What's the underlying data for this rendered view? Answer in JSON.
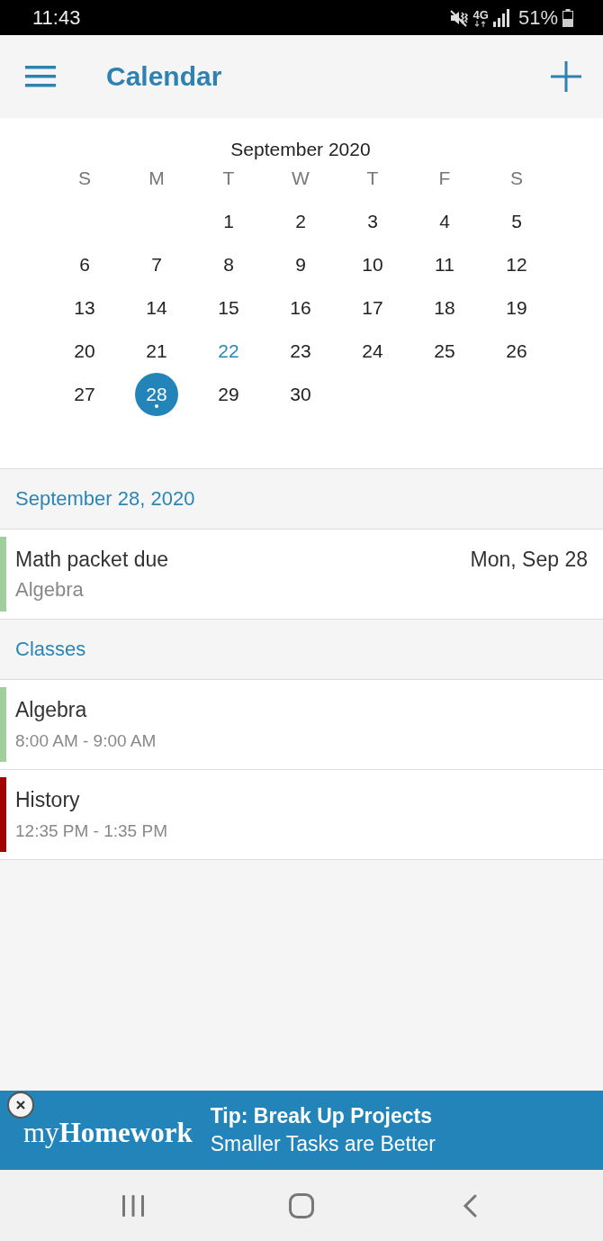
{
  "status_bar": {
    "time": "11:43",
    "network": "4G",
    "battery": "51%"
  },
  "app_bar": {
    "title": "Calendar"
  },
  "calendar": {
    "month": "September 2020",
    "weekdays": [
      "S",
      "M",
      "T",
      "W",
      "T",
      "F",
      "S"
    ],
    "weeks": [
      [
        {
          "day": "1",
          "selected": false,
          "today": false,
          "event": false
        },
        {
          "day": "2",
          "selected": false,
          "today": false,
          "event": false
        },
        {
          "day": "3",
          "selected": false,
          "today": false,
          "event": false
        },
        {
          "day": "4",
          "selected": false,
          "today": false,
          "event": false
        },
        {
          "day": "5",
          "selected": false,
          "today": false,
          "event": false
        }
      ],
      [
        {
          "day": "6",
          "selected": false,
          "today": false,
          "event": false
        },
        {
          "day": "7",
          "selected": false,
          "today": false,
          "event": false
        },
        {
          "day": "8",
          "selected": false,
          "today": false,
          "event": false
        },
        {
          "day": "9",
          "selected": false,
          "today": false,
          "event": false
        },
        {
          "day": "10",
          "selected": false,
          "today": false,
          "event": false
        },
        {
          "day": "11",
          "selected": false,
          "today": false,
          "event": false
        },
        {
          "day": "12",
          "selected": false,
          "today": false,
          "event": false
        }
      ],
      [
        {
          "day": "13",
          "selected": false,
          "today": false,
          "event": false
        },
        {
          "day": "14",
          "selected": false,
          "today": false,
          "event": false
        },
        {
          "day": "15",
          "selected": false,
          "today": false,
          "event": false
        },
        {
          "day": "16",
          "selected": false,
          "today": false,
          "event": false
        },
        {
          "day": "17",
          "selected": false,
          "today": false,
          "event": false
        },
        {
          "day": "18",
          "selected": false,
          "today": false,
          "event": false
        },
        {
          "day": "19",
          "selected": false,
          "today": false,
          "event": false
        }
      ],
      [
        {
          "day": "20",
          "selected": false,
          "today": false,
          "event": false
        },
        {
          "day": "21",
          "selected": false,
          "today": false,
          "event": false
        },
        {
          "day": "22",
          "selected": false,
          "today": true,
          "event": false
        },
        {
          "day": "23",
          "selected": false,
          "today": false,
          "event": false
        },
        {
          "day": "24",
          "selected": false,
          "today": false,
          "event": false
        },
        {
          "day": "25",
          "selected": false,
          "today": false,
          "event": false
        },
        {
          "day": "26",
          "selected": false,
          "today": false,
          "event": false
        }
      ],
      [
        {
          "day": "27",
          "selected": false,
          "today": false,
          "event": false
        },
        {
          "day": "28",
          "selected": true,
          "today": false,
          "event": true
        },
        {
          "day": "29",
          "selected": false,
          "today": false,
          "event": false
        },
        {
          "day": "30",
          "selected": false,
          "today": false,
          "event": false
        }
      ]
    ]
  },
  "sections": [
    {
      "title": "September 28, 2020",
      "items": [
        {
          "kind": "task",
          "title": "Math packet due",
          "subtitle": "Algebra",
          "date": "Mon, Sep 28",
          "color": "#9fd09a"
        }
      ]
    },
    {
      "title": "Classes",
      "items": [
        {
          "kind": "class",
          "title": "Algebra",
          "subtitle": "8:00 AM - 9:00 AM",
          "color": "#9fd09a"
        },
        {
          "kind": "class",
          "title": "History",
          "subtitle": "12:35 PM - 1:35 PM",
          "color": "#a30000"
        }
      ]
    }
  ],
  "banner": {
    "brand": "my**Homework**",
    "title": "Tip: Break Up Projects",
    "text": "Smaller Tasks are Better"
  }
}
